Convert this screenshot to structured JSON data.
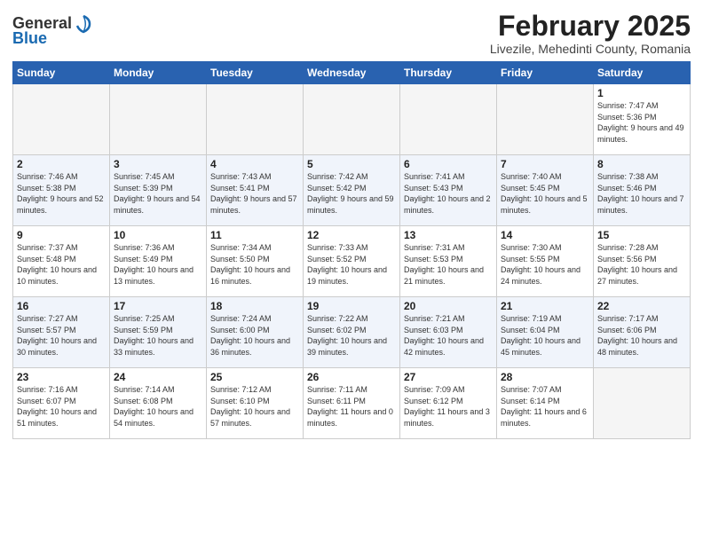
{
  "header": {
    "logo_general": "General",
    "logo_blue": "Blue",
    "month_title": "February 2025",
    "location": "Livezile, Mehedinti County, Romania"
  },
  "weekdays": [
    "Sunday",
    "Monday",
    "Tuesday",
    "Wednesday",
    "Thursday",
    "Friday",
    "Saturday"
  ],
  "weeks": [
    [
      {
        "day": "",
        "empty": true
      },
      {
        "day": "",
        "empty": true
      },
      {
        "day": "",
        "empty": true
      },
      {
        "day": "",
        "empty": true
      },
      {
        "day": "",
        "empty": true
      },
      {
        "day": "",
        "empty": true
      },
      {
        "day": "1",
        "sunrise": "Sunrise: 7:47 AM",
        "sunset": "Sunset: 5:36 PM",
        "daylight": "Daylight: 9 hours and 49 minutes."
      }
    ],
    [
      {
        "day": "2",
        "sunrise": "Sunrise: 7:46 AM",
        "sunset": "Sunset: 5:38 PM",
        "daylight": "Daylight: 9 hours and 52 minutes."
      },
      {
        "day": "3",
        "sunrise": "Sunrise: 7:45 AM",
        "sunset": "Sunset: 5:39 PM",
        "daylight": "Daylight: 9 hours and 54 minutes."
      },
      {
        "day": "4",
        "sunrise": "Sunrise: 7:43 AM",
        "sunset": "Sunset: 5:41 PM",
        "daylight": "Daylight: 9 hours and 57 minutes."
      },
      {
        "day": "5",
        "sunrise": "Sunrise: 7:42 AM",
        "sunset": "Sunset: 5:42 PM",
        "daylight": "Daylight: 9 hours and 59 minutes."
      },
      {
        "day": "6",
        "sunrise": "Sunrise: 7:41 AM",
        "sunset": "Sunset: 5:43 PM",
        "daylight": "Daylight: 10 hours and 2 minutes."
      },
      {
        "day": "7",
        "sunrise": "Sunrise: 7:40 AM",
        "sunset": "Sunset: 5:45 PM",
        "daylight": "Daylight: 10 hours and 5 minutes."
      },
      {
        "day": "8",
        "sunrise": "Sunrise: 7:38 AM",
        "sunset": "Sunset: 5:46 PM",
        "daylight": "Daylight: 10 hours and 7 minutes."
      }
    ],
    [
      {
        "day": "9",
        "sunrise": "Sunrise: 7:37 AM",
        "sunset": "Sunset: 5:48 PM",
        "daylight": "Daylight: 10 hours and 10 minutes."
      },
      {
        "day": "10",
        "sunrise": "Sunrise: 7:36 AM",
        "sunset": "Sunset: 5:49 PM",
        "daylight": "Daylight: 10 hours and 13 minutes."
      },
      {
        "day": "11",
        "sunrise": "Sunrise: 7:34 AM",
        "sunset": "Sunset: 5:50 PM",
        "daylight": "Daylight: 10 hours and 16 minutes."
      },
      {
        "day": "12",
        "sunrise": "Sunrise: 7:33 AM",
        "sunset": "Sunset: 5:52 PM",
        "daylight": "Daylight: 10 hours and 19 minutes."
      },
      {
        "day": "13",
        "sunrise": "Sunrise: 7:31 AM",
        "sunset": "Sunset: 5:53 PM",
        "daylight": "Daylight: 10 hours and 21 minutes."
      },
      {
        "day": "14",
        "sunrise": "Sunrise: 7:30 AM",
        "sunset": "Sunset: 5:55 PM",
        "daylight": "Daylight: 10 hours and 24 minutes."
      },
      {
        "day": "15",
        "sunrise": "Sunrise: 7:28 AM",
        "sunset": "Sunset: 5:56 PM",
        "daylight": "Daylight: 10 hours and 27 minutes."
      }
    ],
    [
      {
        "day": "16",
        "sunrise": "Sunrise: 7:27 AM",
        "sunset": "Sunset: 5:57 PM",
        "daylight": "Daylight: 10 hours and 30 minutes."
      },
      {
        "day": "17",
        "sunrise": "Sunrise: 7:25 AM",
        "sunset": "Sunset: 5:59 PM",
        "daylight": "Daylight: 10 hours and 33 minutes."
      },
      {
        "day": "18",
        "sunrise": "Sunrise: 7:24 AM",
        "sunset": "Sunset: 6:00 PM",
        "daylight": "Daylight: 10 hours and 36 minutes."
      },
      {
        "day": "19",
        "sunrise": "Sunrise: 7:22 AM",
        "sunset": "Sunset: 6:02 PM",
        "daylight": "Daylight: 10 hours and 39 minutes."
      },
      {
        "day": "20",
        "sunrise": "Sunrise: 7:21 AM",
        "sunset": "Sunset: 6:03 PM",
        "daylight": "Daylight: 10 hours and 42 minutes."
      },
      {
        "day": "21",
        "sunrise": "Sunrise: 7:19 AM",
        "sunset": "Sunset: 6:04 PM",
        "daylight": "Daylight: 10 hours and 45 minutes."
      },
      {
        "day": "22",
        "sunrise": "Sunrise: 7:17 AM",
        "sunset": "Sunset: 6:06 PM",
        "daylight": "Daylight: 10 hours and 48 minutes."
      }
    ],
    [
      {
        "day": "23",
        "sunrise": "Sunrise: 7:16 AM",
        "sunset": "Sunset: 6:07 PM",
        "daylight": "Daylight: 10 hours and 51 minutes."
      },
      {
        "day": "24",
        "sunrise": "Sunrise: 7:14 AM",
        "sunset": "Sunset: 6:08 PM",
        "daylight": "Daylight: 10 hours and 54 minutes."
      },
      {
        "day": "25",
        "sunrise": "Sunrise: 7:12 AM",
        "sunset": "Sunset: 6:10 PM",
        "daylight": "Daylight: 10 hours and 57 minutes."
      },
      {
        "day": "26",
        "sunrise": "Sunrise: 7:11 AM",
        "sunset": "Sunset: 6:11 PM",
        "daylight": "Daylight: 11 hours and 0 minutes."
      },
      {
        "day": "27",
        "sunrise": "Sunrise: 7:09 AM",
        "sunset": "Sunset: 6:12 PM",
        "daylight": "Daylight: 11 hours and 3 minutes."
      },
      {
        "day": "28",
        "sunrise": "Sunrise: 7:07 AM",
        "sunset": "Sunset: 6:14 PM",
        "daylight": "Daylight: 11 hours and 6 minutes."
      },
      {
        "day": "",
        "empty": true
      }
    ]
  ]
}
